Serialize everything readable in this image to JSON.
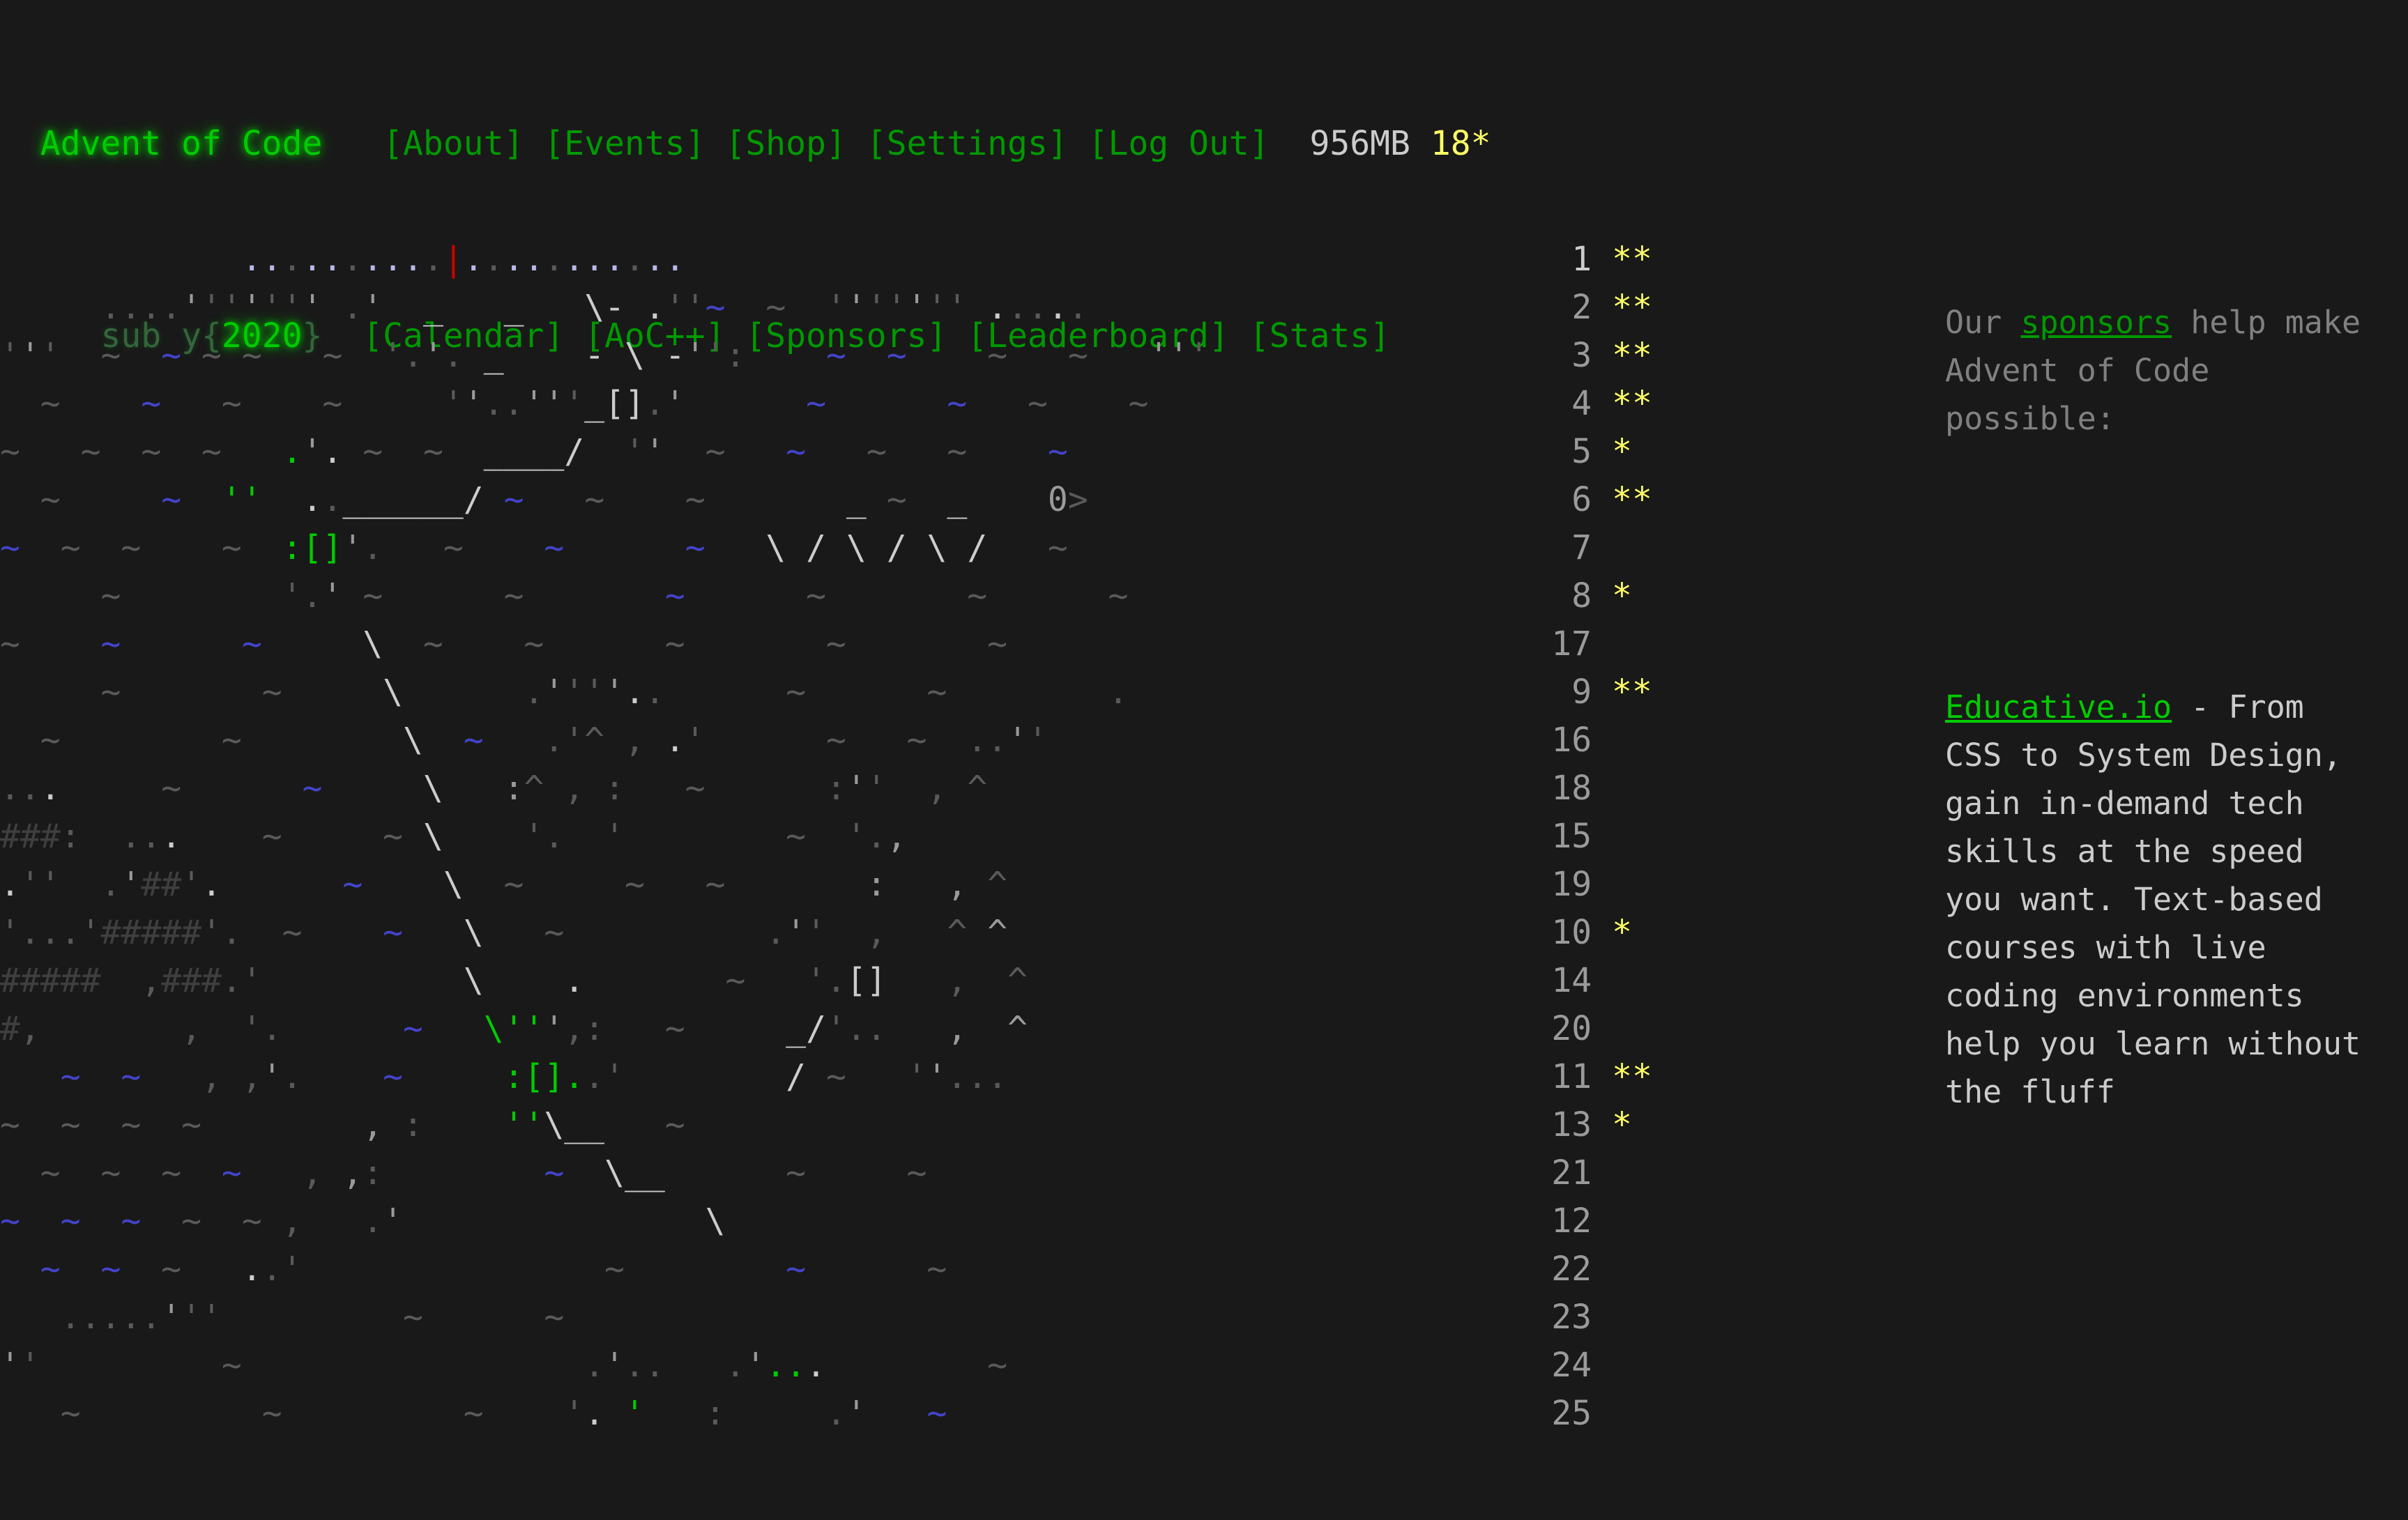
{
  "site": {
    "brand": "Advent of Code",
    "sub_prefix": "sub y{",
    "sub_year": "2020",
    "sub_suffix": "}",
    "memory": "956MB",
    "star_count": "18*"
  },
  "nav": {
    "row1": [
      {
        "label": "[About]",
        "name": "nav-about"
      },
      {
        "label": "[Events]",
        "name": "nav-events"
      },
      {
        "label": "[Shop]",
        "name": "nav-shop"
      },
      {
        "label": "[Settings]",
        "name": "nav-settings"
      },
      {
        "label": "[Log Out]",
        "name": "nav-logout"
      }
    ],
    "row2": [
      {
        "label": "[Calendar]",
        "name": "nav-calendar"
      },
      {
        "label": "[AoC++]",
        "name": "nav-aocpp"
      },
      {
        "label": "[Sponsors]",
        "name": "nav-sponsors"
      },
      {
        "label": "[Leaderboard]",
        "name": "nav-leaderboard"
      },
      {
        "label": "[Stats]",
        "name": "nav-stats"
      }
    ]
  },
  "sponsor": {
    "line_a_pre": "Our ",
    "line_a_link": "sponsors",
    "line_a_post": " help make Advent of Code possible:",
    "name": "Educative.io",
    "dash": " - ",
    "body": "From CSS to System Design, gain in-demand tech skills at the speed you want. Text-based courses with live coding environments help you learn without the fluff"
  },
  "calendar": {
    "days": [
      {
        "day": "1",
        "stars": "**",
        "highlight": true
      },
      {
        "day": "2",
        "stars": "**",
        "highlight": false
      },
      {
        "day": "3",
        "stars": "**",
        "highlight": false
      },
      {
        "day": "4",
        "stars": "**",
        "highlight": false
      },
      {
        "day": "5",
        "stars": "*",
        "highlight": false
      },
      {
        "day": "6",
        "stars": "**",
        "highlight": false
      },
      {
        "day": "7",
        "stars": "",
        "highlight": false
      },
      {
        "day": "8",
        "stars": "*",
        "highlight": false
      },
      {
        "day": "17",
        "stars": "",
        "highlight": false
      },
      {
        "day": "9",
        "stars": "**",
        "highlight": false
      },
      {
        "day": "16",
        "stars": "",
        "highlight": false
      },
      {
        "day": "18",
        "stars": "",
        "highlight": false
      },
      {
        "day": "15",
        "stars": "",
        "highlight": false
      },
      {
        "day": "19",
        "stars": "",
        "highlight": false
      },
      {
        "day": "10",
        "stars": "*",
        "highlight": false
      },
      {
        "day": "14",
        "stars": "",
        "highlight": false
      },
      {
        "day": "20",
        "stars": "",
        "highlight": false
      },
      {
        "day": "11",
        "stars": "**",
        "highlight": false
      },
      {
        "day": "13",
        "stars": "*",
        "highlight": false
      },
      {
        "day": "21",
        "stars": "",
        "highlight": false
      },
      {
        "day": "12",
        "stars": "",
        "highlight": false
      },
      {
        "day": "22",
        "stars": "",
        "highlight": false
      },
      {
        "day": "23",
        "stars": "",
        "highlight": false
      },
      {
        "day": "24",
        "stars": "",
        "highlight": false
      },
      {
        "day": "25",
        "stars": "",
        "highlight": false
      }
    ],
    "art_rows": [
      "            ..........|...........",
      "     ....''''''' .'  _   _   \\- .''~  ~  ''''''' .....",
      "'''  ~  ~ ~ ~   ~  '.'. _    - \\ -'':    ~  ~    ~   ~   '''",
      "  ~    ~   ~    ~     ''..'''_[].'      ~      ~   ~    ~",
      "~   ~  ~  ~   .'. ~  ~  ____/  ''  ~   ~   ~   ~    ~",
      "  ~     ~  ''  ..______/ ~   ~    ~       _ ~  _    0>",
      "~  ~  ~    ~  :[]'.   ~    ~      ~   \\ / \\ / \\ /   ~",
      "     ~        '.' ~      ~       ~      ~       ~      ~",
      "~    ~      ~     \\  ~    ~      ~       ~       ~",
      "     ~       ~     \\      .''''..      ~      ~        .",
      "  ~        ~        \\  ~   .'^ , .'      ~   ~  ..''",
      "...     ~      ~     \\   :^ , :   ~      :''  , ^",
      "###:  ...    ~     ~ \\    '.  '        ~  '., ",
      ".''  .'##'.      ~    \\  ~     ~   ~       :   , ^",
      "'...'#####'.  ~    ~   \\   ~          .''  ,   ^ ^",
      "#####  ,###.'          \\    .       ~   '.[]   ,  ^",
      "#,       ,  '.      ~   \\''',:   ~     _/'..   ,  ^",
      "   ~  ~   , ,'.    ~     :[]..'        / ~   ''...",
      "~  ~  ~  ~        , :    ''\\__   ~",
      "  ~  ~  ~  ~   , ,:        ~  \\__      ~     ~",
      "~  ~  ~  ~  ~ ,   .'               \\",
      "  ~  ~  ~   ..'               ~        ~      ~",
      "   .....'''         ~      ~",
      "''         ~                 .'..   .'...        ~",
      "   ~         ~         ~    '. '   :     .'   ~"
    ]
  }
}
